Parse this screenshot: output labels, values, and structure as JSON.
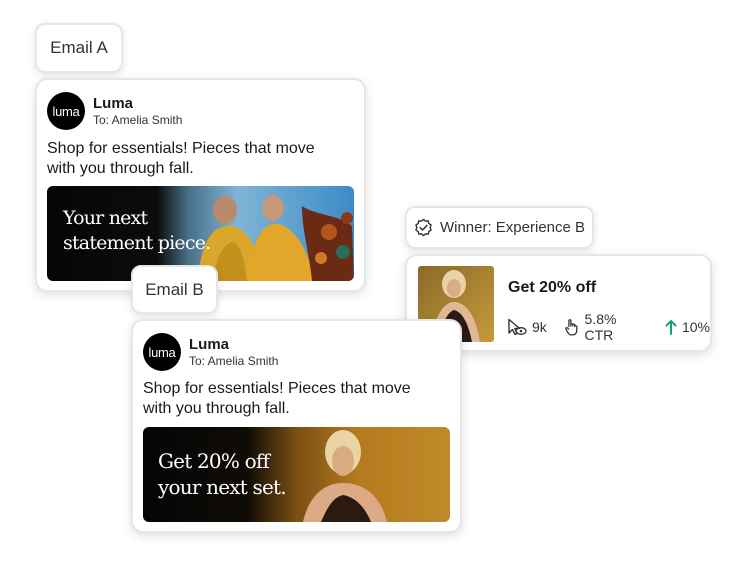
{
  "email_a": {
    "tag": "Email A",
    "sender": "Luma",
    "logo_text": "luma",
    "recipient": "To: Amelia Smith",
    "body": "Shop for essentials! Pieces that move with you through fall.",
    "banner_text": "Your next\nstatement piece."
  },
  "email_b": {
    "tag": "Email B",
    "sender": "Luma",
    "logo_text": "luma",
    "recipient": "To: Amelia Smith",
    "body": "Shop for essentials! Pieces that move with you through fall.",
    "banner_text": "Get 20% off\nyour next set."
  },
  "winner": {
    "label": "Winner: Experience B",
    "headline": "Get 20% off",
    "views": "9k",
    "ctr": "5.8% CTR",
    "lift": "10%",
    "lift_color": "#12a37a"
  },
  "icons": [
    "badge-check-icon",
    "eye-cursor-icon",
    "click-hand-icon",
    "arrow-up-icon"
  ]
}
